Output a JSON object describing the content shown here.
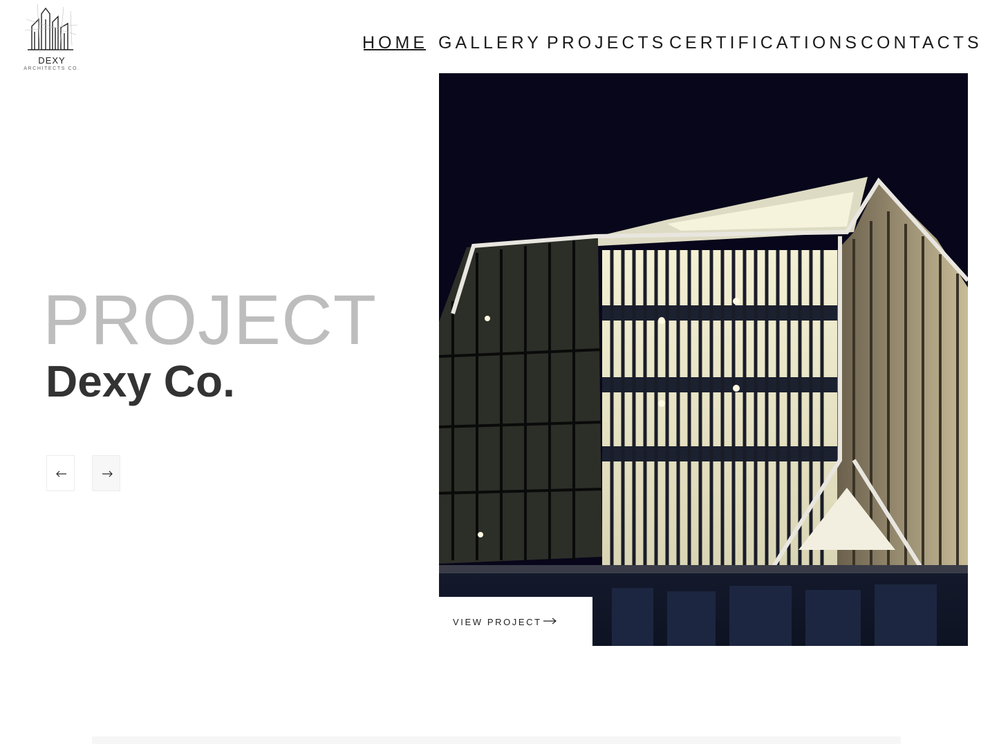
{
  "brand": {
    "name": "DEXY",
    "tagline": "ARCHITECTS CO."
  },
  "nav": {
    "items": [
      {
        "label": "HOME",
        "active": true
      },
      {
        "label": "GALLERY",
        "active": false
      },
      {
        "label": "PROJECTS",
        "active": false
      },
      {
        "label": "CERTIFICATIONS",
        "active": false
      },
      {
        "label": "CONTACTS",
        "active": false
      }
    ]
  },
  "hero": {
    "kicker": "PROJECT",
    "title": "Dexy Co.",
    "cta_label": "VIEW PROJECT"
  },
  "icons": {
    "prev": "arrow-left-icon",
    "next": "arrow-right-icon",
    "cta": "arrow-right-icon"
  },
  "colors": {
    "text_dark": "#1b1b1b",
    "kicker_gray": "#bdbdbd",
    "title_gray": "#333333",
    "night_sky": "#07061a"
  }
}
